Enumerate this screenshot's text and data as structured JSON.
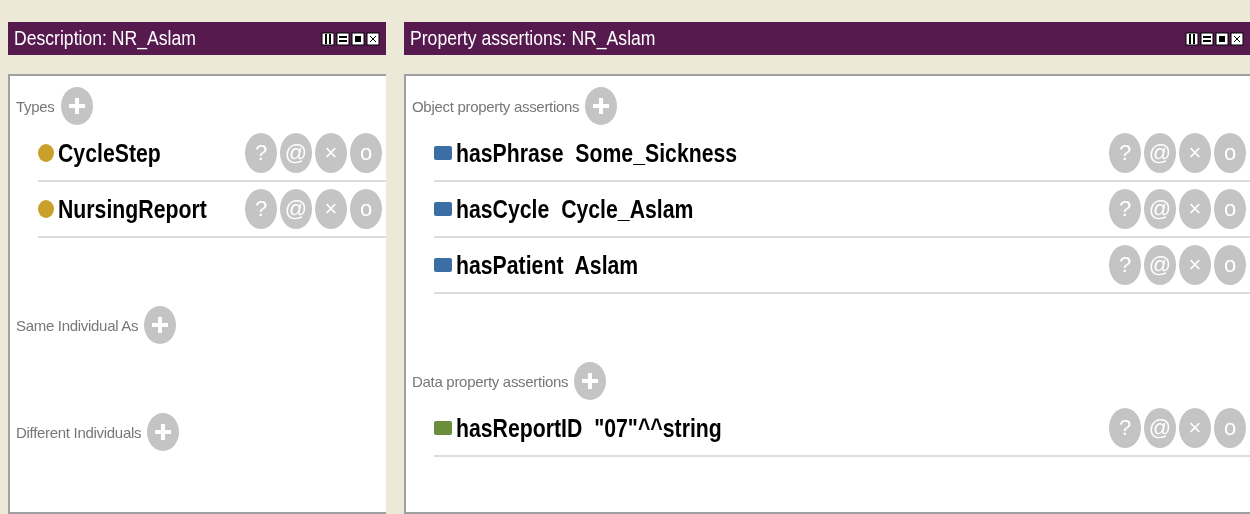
{
  "panels": [
    {
      "title": "Description: NR_Aslam",
      "sections": [
        {
          "label": "Types",
          "rows": [
            {
              "kind": "class",
              "color": "#c9a02c",
              "text": "CycleStep",
              "buttons": [
                "?",
                "@",
                "×",
                "o"
              ]
            },
            {
              "kind": "class",
              "color": "#c9a02c",
              "text": "NursingReport",
              "buttons": [
                "?",
                "@",
                "×",
                "o"
              ]
            }
          ]
        },
        {
          "label": "Same Individual As"
        },
        {
          "label": "Different Individuals"
        }
      ]
    },
    {
      "title": "Property assertions: NR_Aslam",
      "sections": [
        {
          "label": "Object property assertions",
          "rows": [
            {
              "kind": "property",
              "color": "#3a6ea5",
              "text": "hasPhrase  Some_Sickness",
              "buttons": [
                "?",
                "@",
                "×",
                "o"
              ]
            },
            {
              "kind": "property",
              "color": "#3a6ea5",
              "text": "hasCycle  Cycle_Aslam",
              "buttons": [
                "?",
                "@",
                "×",
                "o"
              ]
            },
            {
              "kind": "property",
              "color": "#3a6ea5",
              "text": "hasPatient  Aslam",
              "buttons": [
                "?",
                "@",
                "×",
                "o"
              ]
            }
          ]
        },
        {
          "label": "Data property assertions",
          "rows": [
            {
              "kind": "property",
              "color": "#6b8e3a",
              "text": "hasReportID  \"07\"^^string",
              "buttons": [
                "?",
                "@",
                "×",
                "o"
              ]
            }
          ]
        }
      ]
    }
  ]
}
